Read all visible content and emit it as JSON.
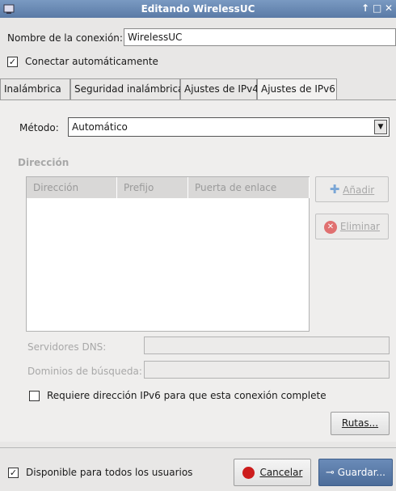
{
  "window": {
    "title": "Editando WirelessUC",
    "controls": [
      "↑",
      "□",
      "✕"
    ]
  },
  "connection": {
    "name_label": "Nombre de la conexión:",
    "name_value": "WirelessUC",
    "autoconnect_label": "Conectar automáticamente",
    "autoconnect_checked": "✓"
  },
  "tabs": [
    "Inalámbrica",
    "Seguridad inalámbrica",
    "Ajustes de IPv4",
    "Ajustes de IPv6"
  ],
  "ipv6": {
    "method_label": "Método:",
    "method_value": "Automático",
    "address_section": "Dirección",
    "columns": [
      "Dirección",
      "Prefijo",
      "Puerta de enlace"
    ],
    "add_button": "Añadir",
    "delete_button": "Eliminar",
    "dns_label": "Servidores DNS:",
    "search_label": "Dominios de búsqueda:",
    "require_label": "Requiere dirección IPv6 para que esta conexión complete",
    "routes_button": "Rutas..."
  },
  "footer": {
    "all_users_label": "Disponible para todos los usuarios",
    "all_users_checked": "✓",
    "cancel_button": "Cancelar",
    "save_button": "Guardar..."
  },
  "colors": {
    "titlebar": "#5a7aa6",
    "save_button": "#4d6d9a",
    "cancel_icon": "#cc1c1c",
    "add_icon": "#7aa6d6"
  }
}
